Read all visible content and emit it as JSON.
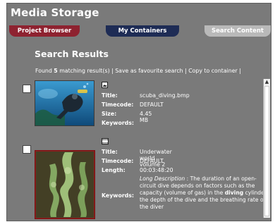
{
  "app": {
    "title": "Media Storage"
  },
  "tabs": [
    {
      "label": "Project Browser",
      "color": "#8e2230"
    },
    {
      "label": "My Containers",
      "color": "#1e2c55"
    },
    {
      "label": "Search Content",
      "color": "#b9b9b9"
    }
  ],
  "results": {
    "title": "Search Results",
    "found_prefix": "Found ",
    "found_count": "5",
    "found_suffix": " matching result(s)",
    "sep1": " | ",
    "save_link": "Save as favourite search",
    "sep2": " | ",
    "copy_link": "Copy to container",
    "sep3": " |",
    "items": [
      {
        "icon": "image-icon",
        "title_label": "Title:",
        "title": "scuba_diving.bmp",
        "timecode_label": "Timecode:",
        "timecode": "DEFAULT",
        "size_label": "Size:",
        "size": "4.45 MB",
        "keywords_label": "Keywords:"
      },
      {
        "icon": "film-icon",
        "title_label": "Title:",
        "title": "Underwater world volume 2",
        "timecode_label": "Timecode:",
        "timecode": "DEFAULT",
        "length_label": "Length:",
        "length": "00:03:48:20",
        "keywords_label": "Keywords:",
        "desc_label": "Long Description",
        "desc_part1": " : The duration of an open-circuit dive depends on factors such as the capacity (volume of gas) in the ",
        "desc_bold": "diving",
        "desc_part2": " cylinder, the depth of the dive and the breathing rate of the diver"
      }
    ]
  }
}
